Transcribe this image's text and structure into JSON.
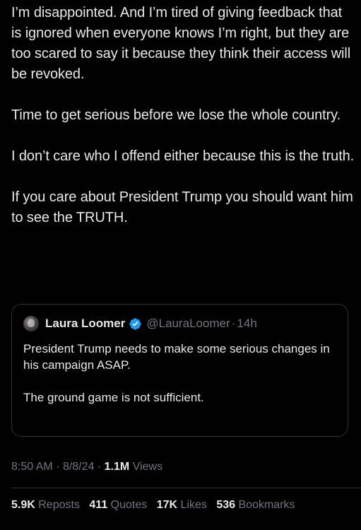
{
  "tweet": {
    "paragraphs": [
      "I’m disappointed. And I’m tired of giving feedback that is ignored when everyone knows I’m right, but they are too scared to say it because they think their access will be revoked.",
      "Time to get serious before we lose the whole country.",
      "I don’t care who I offend either because this is the truth.",
      "If you care about President Trump you should want him to see the TRUTH."
    ]
  },
  "quote": {
    "author_name": "Laura Loomer",
    "handle": "@LauraLoomer",
    "separator": "·",
    "time_ago": "14h",
    "paragraphs": [
      "President Trump needs to make some serious changes in his campaign ASAP.",
      "The ground game is not sufficient."
    ]
  },
  "meta": {
    "time": "8:50 AM",
    "sep1": "·",
    "date": "8/8/24",
    "sep2": "·",
    "views_count": "1.1M",
    "views_label": "Views"
  },
  "stats": {
    "reposts": {
      "count": "5.9K",
      "label": "Reposts"
    },
    "quotes": {
      "count": "411",
      "label": "Quotes"
    },
    "likes": {
      "count": "17K",
      "label": "Likes"
    },
    "bookmarks": {
      "count": "536",
      "label": "Bookmarks"
    }
  },
  "colors": {
    "background": "#000000",
    "text": "#e7e9ea",
    "muted": "#71767b",
    "border": "#2f3336",
    "verified": "#1d9bf0"
  },
  "icons": {
    "verified": "verified-badge-icon"
  }
}
